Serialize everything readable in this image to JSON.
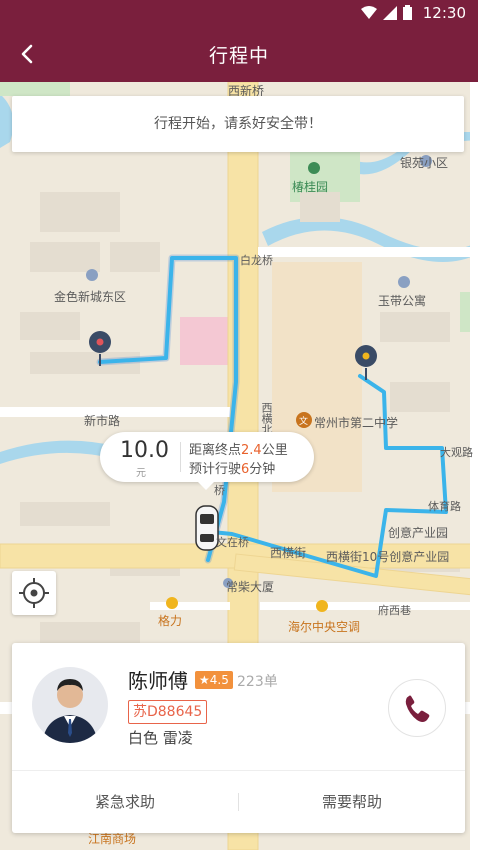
{
  "status_bar": {
    "time": "12:30"
  },
  "header": {
    "title": "行程中"
  },
  "notice": {
    "text": "行程开始，请系好安全带！"
  },
  "map": {
    "labels": {
      "xinan_bridge": "西新桥",
      "yinyuan": "银苑小区",
      "chungui_garden": "椿桂园",
      "bailong_bridge": "白龙桥",
      "jinse_xincheng": "金色新城东区",
      "yudai": "玉带公寓",
      "xishi_road": "新市路",
      "changzhou_school": "常州市第二中学",
      "xiheng_street": "西横街",
      "creative_park": "创意产业园",
      "creative_park_full": "西横街10号创意产业园",
      "changchai": "常柴大厦",
      "haier": "海尔中央空调",
      "fuxi_lane": "府西巷",
      "gli": "格力",
      "jiangnan": "江南商场",
      "xiheng_north": "西横北弄",
      "dahui": "大观路",
      "tiyu": "体育路",
      "wenzai": "文在桥",
      "qiao": "桥"
    },
    "colors": {
      "route": "#3bb4ea",
      "accent": "#7a1f3d"
    }
  },
  "trip_info": {
    "fare": "10.0",
    "fare_unit": "元",
    "distance_prefix": "距离终点",
    "distance_value": "2.4",
    "distance_unit": "公里",
    "time_prefix": "预计行驶",
    "time_value": "6",
    "time_unit": "分钟"
  },
  "driver": {
    "name": "陈师傅",
    "rating": "★4.5",
    "orders": "223单",
    "plate": "苏D88645",
    "car": "白色 雷凌"
  },
  "actions": {
    "emergency": "紧急求助",
    "help": "需要帮助"
  }
}
